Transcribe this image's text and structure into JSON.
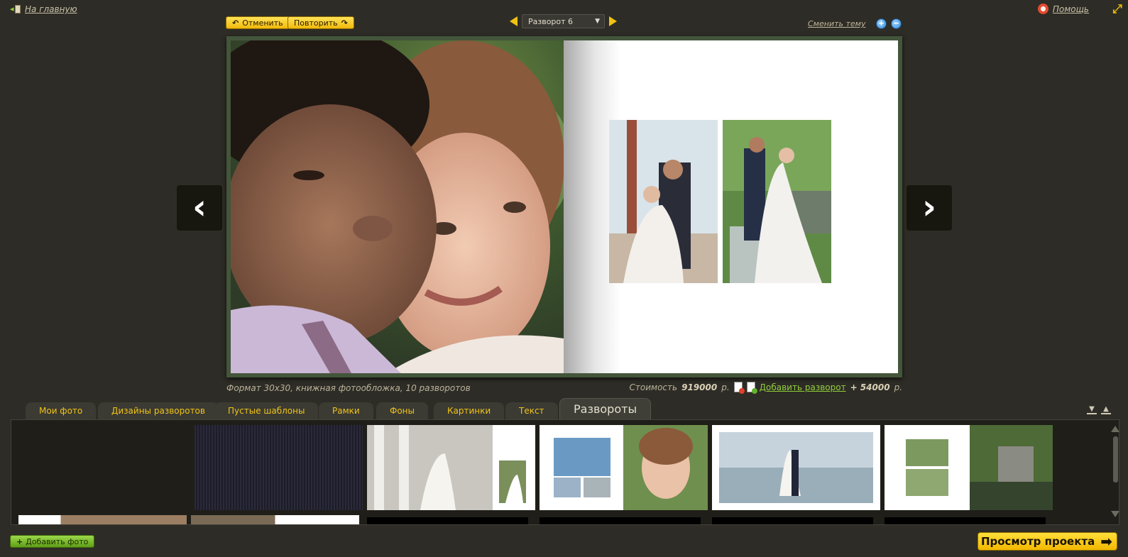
{
  "top": {
    "home_label": "На главную",
    "help_label": "Помощь",
    "undo_label": "Отменить",
    "redo_label": "Повторить",
    "spread_selected": "Разворот 6",
    "theme_label": "Сменить тему"
  },
  "info": {
    "format": "Формат 30х30, книжная фотообложка, 10 разворотов",
    "cost_label": "Стоимость",
    "cost_value": "919000",
    "currency": "р.",
    "add_spread_label": "Добавить разворот",
    "add_spread_price": "+ 54000",
    "add_spread_currency": "р."
  },
  "tabs": [
    {
      "label": "Мои фото"
    },
    {
      "label": "Дизайны разворотов"
    },
    {
      "label": "Пустые шаблоны"
    },
    {
      "label": "Рамки"
    },
    {
      "label": "Фоны"
    },
    {
      "label": "Картинки"
    },
    {
      "label": "Текст"
    },
    {
      "label": "Развороты"
    }
  ],
  "active_tab": "Развороты",
  "bottom": {
    "add_photo_label": "Добавить фото",
    "preview_label": "Просмотр проекта"
  },
  "icons": {
    "home": "exit-door-icon",
    "help": "lifebuoy-icon",
    "fullscreen": "fullscreen-icon",
    "zoom_in": "zoom-in-icon",
    "zoom_out": "zoom-out-icon",
    "prev": "chevron-left-icon",
    "next": "chevron-right-icon"
  },
  "colors": {
    "background": "#2e2c26",
    "accent_yellow": "#f1c211",
    "accent_green": "#8fcf3b"
  }
}
